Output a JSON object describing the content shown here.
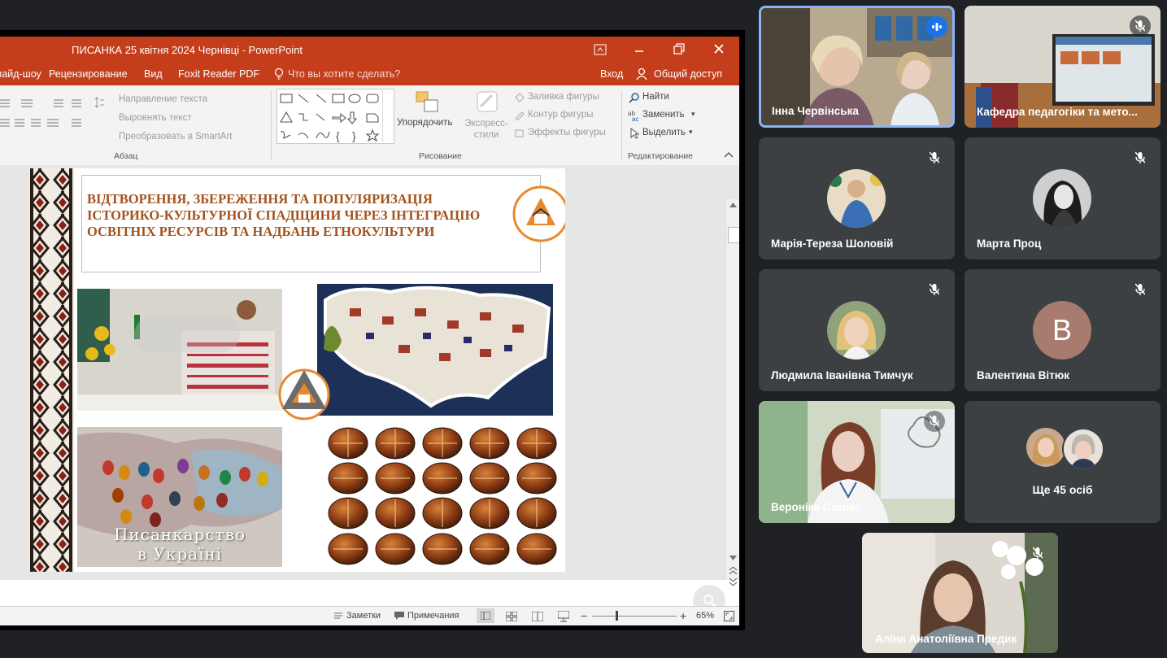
{
  "powerpoint": {
    "title": "ПИСАНКА 25 квітня 2024 Чернівці - PowerPoint",
    "menu": [
      "Слайд-шоу",
      "Рецензирование",
      "Вид",
      "Foxit Reader PDF"
    ],
    "tell_me": "Что вы хотите сделать?",
    "login": "Вход",
    "share": "Общий доступ",
    "ribbon": {
      "text_direction": "Направление текста",
      "align_text": "Выровнять текст",
      "smartart": "Преобразовать в SmartArt",
      "paragraph_group": "Абзац",
      "arrange": "Упорядочить",
      "quick_styles": "Экспресс-стили",
      "shape_fill": "Заливка фигуры",
      "shape_outline": "Контур фигуры",
      "shape_effects": "Эффекты фигуры",
      "drawing_group": "Рисование",
      "find": "Найти",
      "replace": "Заменить",
      "select": "Выделить",
      "editing_group": "Редактирование"
    },
    "slide": {
      "heading_lines": [
        "ВІДТВОРЕННЯ, ЗБЕРЕЖЕННЯ ТА ПОПУЛЯРИЗАЦІЯ",
        "ІСТОРИКО-КУЛЬТУРНОЇ СПАДЩИНИ ЧЕРЕЗ ІНТЕГРАЦІЮ",
        "ОСВІТНІХ РЕСУРСІВ ТА НАДБАНЬ ЕТНОКУЛЬТУРИ"
      ],
      "map_caption_1": "Писанкарство",
      "map_caption_2": "в Україні"
    },
    "status": {
      "notes": "Заметки",
      "comments": "Примечания",
      "zoom": "65%"
    }
  },
  "participants": [
    {
      "name": "Інна Червінська",
      "speaking": true
    },
    {
      "name": "Кафедра педагогіки та мето..."
    },
    {
      "name": "Марія-Тереза Шоловій"
    },
    {
      "name": "Марта Проц"
    },
    {
      "name": "Людмила Іванівна Тимчук"
    },
    {
      "name": "Валентина Вітюк",
      "initial": "В"
    },
    {
      "name": "Вероніка Озарко"
    },
    {
      "name": "Ще 45 осіб"
    },
    {
      "name": "Аліна Анатоліївна Предик"
    }
  ],
  "colors": {
    "accent_speaking": "#8ab4f8",
    "powerpoint": "#c43e1c",
    "tile_bg": "#3c4043",
    "avatar_b": "#a87b6f"
  }
}
